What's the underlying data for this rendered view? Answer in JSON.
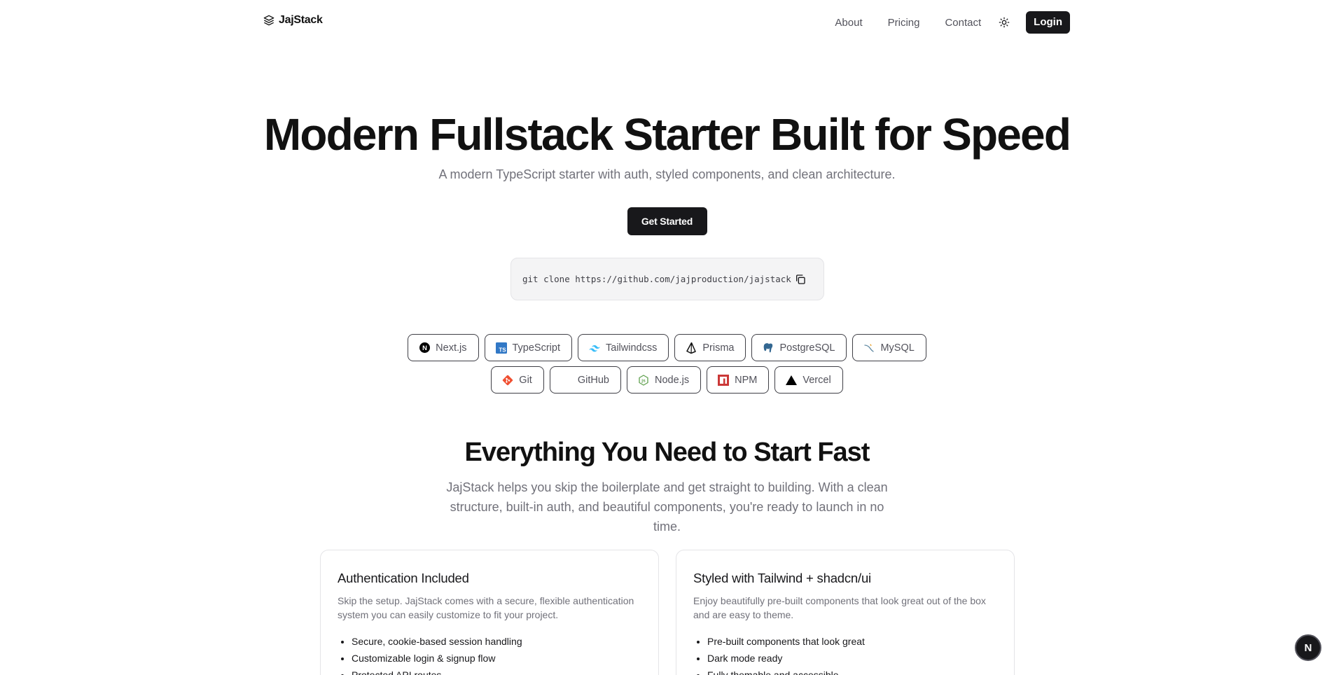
{
  "header": {
    "logo_text": "JajStack",
    "nav": [
      {
        "label": "About"
      },
      {
        "label": "Pricing"
      },
      {
        "label": "Contact"
      }
    ],
    "theme_icon": "sun-icon",
    "login_label": "Login"
  },
  "hero": {
    "title": "Modern Fullstack Starter Built for Speed",
    "subtitle": "A modern TypeScript starter with auth, styled components, and clean architecture.",
    "cta_label": "Get Started",
    "clone_command": "git clone https://github.com/jajproduction/jajstack",
    "copy_icon": "copy-icon"
  },
  "tech": {
    "row1": [
      {
        "label": "Next.js",
        "icon": "nextjs-icon"
      },
      {
        "label": "TypeScript",
        "icon": "typescript-icon"
      },
      {
        "label": "Tailwindcss",
        "icon": "tailwind-icon"
      },
      {
        "label": "Prisma",
        "icon": "prisma-icon"
      },
      {
        "label": "PostgreSQL",
        "icon": "postgresql-icon"
      },
      {
        "label": "MySQL",
        "icon": "mysql-icon"
      }
    ],
    "row2": [
      {
        "label": "Git",
        "icon": "git-icon"
      },
      {
        "label": "GitHub",
        "icon": "github-icon"
      },
      {
        "label": "Node.js",
        "icon": "nodejs-icon"
      },
      {
        "label": "NPM",
        "icon": "npm-icon"
      },
      {
        "label": "Vercel",
        "icon": "vercel-icon"
      }
    ]
  },
  "features": {
    "title": "Everything You Need to Start Fast",
    "description": "JajStack helps you skip the boilerplate and get straight to building. With a clean structure, built-in auth, and beautiful components, you're ready to launch in no time.",
    "cards": [
      {
        "title": "Authentication Included",
        "description": "Skip the setup. JajStack comes with a secure, flexible authentication system you can easily customize to fit your project.",
        "items": [
          "Secure, cookie-based session handling",
          "Customizable login & signup flow",
          "Protected API routes"
        ]
      },
      {
        "title": "Styled with Tailwind + shadcn/ui",
        "description": "Enjoy beautifully pre-built components that look great out of the box and are easy to theme.",
        "items": [
          "Pre-built components that look great",
          "Dark mode ready",
          "Fully themable and accessible"
        ]
      }
    ]
  },
  "fab_label": "N",
  "colors": {
    "primary": "#18181b",
    "muted_text": "#71717a",
    "border": "#e4e4e7"
  }
}
